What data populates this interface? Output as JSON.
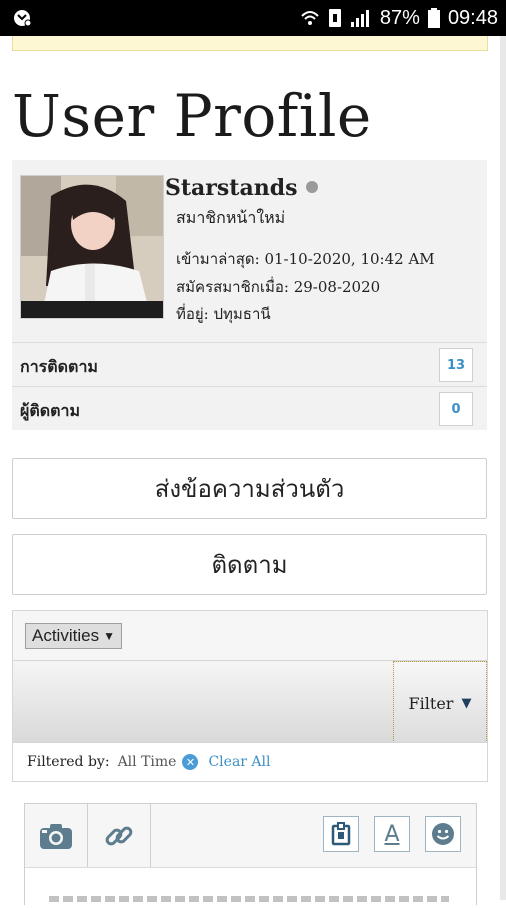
{
  "status_bar": {
    "battery": "87%",
    "time": "09:48"
  },
  "page": {
    "title": "User Profile"
  },
  "profile": {
    "username": "Starstands",
    "rank": "สมาชิกหน้าใหม่",
    "last_seen": "เข้ามาล่าสุด: 01-10-2020, 10:42 AM",
    "registered": "สมัครสมาชิกเมื่อ: 29-08-2020",
    "location": "ที่อยู่: ปทุมธานี"
  },
  "stats": [
    {
      "label": "การติดตาม",
      "count": "13"
    },
    {
      "label": "ผู้ติดตาม",
      "count": "0"
    }
  ],
  "actions": {
    "message_label": "ส่งข้อความส่วนตัว",
    "follow_label": "ติดตาม"
  },
  "activities": {
    "select_value": "Activities",
    "filter_label": "Filter"
  },
  "filter_summary": {
    "label": "Filtered by:",
    "value": "All Time",
    "clear_label": "Clear All"
  },
  "colors": {
    "accent": "#3b8fc5",
    "status_dot": "#9a9a9a"
  }
}
